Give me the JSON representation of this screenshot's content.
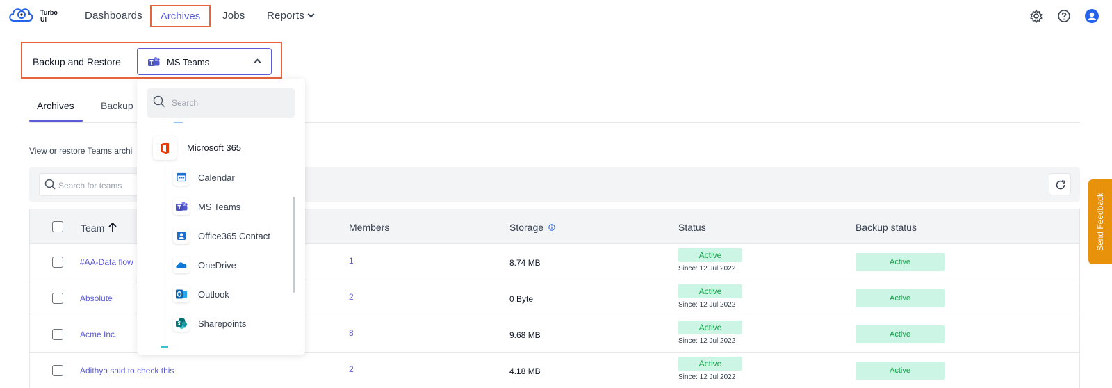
{
  "app": {
    "logo_text": "Turbo UI"
  },
  "nav": {
    "items": [
      "Dashboards",
      "Archives",
      "Jobs",
      "Reports"
    ],
    "active": "Archives"
  },
  "icons": {
    "settings": "gear-icon",
    "help": "help-circle-icon",
    "user": "user-avatar-icon"
  },
  "colors": {
    "accent": "#5b5bd6",
    "highlight": "#e8643c",
    "success_bg": "#cdf5e6",
    "success_text": "#16a34a",
    "feedback": "#e8920b"
  },
  "backup_restore": {
    "label": "Backup and Restore",
    "selected": "MS Teams"
  },
  "tabs": [
    "Archives",
    "Backup"
  ],
  "description": "View or restore Teams archi",
  "team_search": {
    "placeholder": "Search for teams"
  },
  "dropdown": {
    "search_placeholder": "Search",
    "group": "Microsoft 365",
    "items": [
      "Calendar",
      "MS Teams",
      "Office365 Contact",
      "OneDrive",
      "Outlook",
      "Sharepoints"
    ]
  },
  "table": {
    "headers": [
      "Team",
      "Members",
      "Storage",
      "Status",
      "Backup status"
    ],
    "rows": [
      {
        "team": "#AA-Data flow",
        "members": "1",
        "storage": "8.74 MB",
        "status": "Active",
        "since": "Since: 12 Jul 2022",
        "backup": "Active"
      },
      {
        "team": "Absolute",
        "members": "2",
        "storage": "0 Byte",
        "status": "Active",
        "since": "Since: 12 Jul 2022",
        "backup": "Active"
      },
      {
        "team": "Acme Inc.",
        "members": "8",
        "storage": "9.68 MB",
        "status": "Active",
        "since": "Since: 12 Jul 2022",
        "backup": "Active"
      },
      {
        "team": "Adithya said to check this",
        "members": "2",
        "storage": "4.18 MB",
        "status": "Active",
        "since": "Since: 12 Jul 2022",
        "backup": "Active"
      }
    ]
  },
  "feedback": {
    "label": "Send Feedback"
  }
}
